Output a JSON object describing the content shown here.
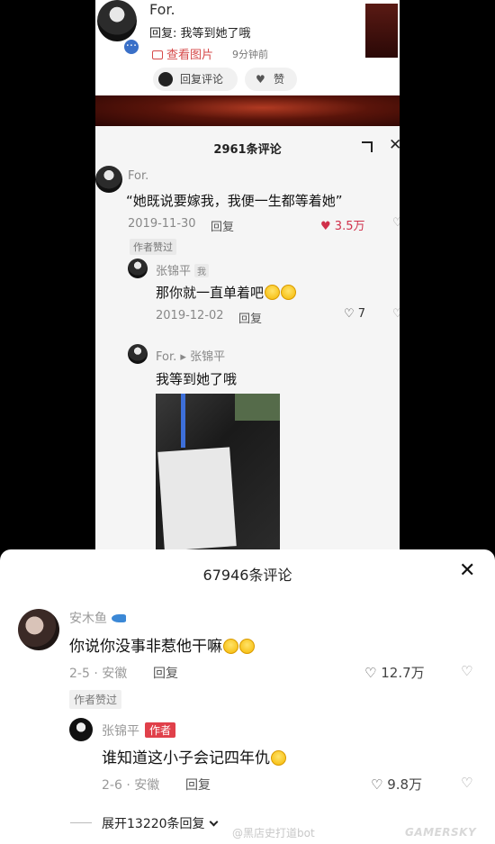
{
  "notification": {
    "username": "For.",
    "reply_text": "回复: 我等到她了哦",
    "view_image": "查看图片",
    "time": "9分钟前",
    "plus_badge": "···",
    "reply_comment_button": "回复评论",
    "like_button": "赞"
  },
  "top_comments": {
    "title": "2961条评论",
    "close": "✕",
    "comment1": {
      "name": "For.",
      "text": "“她既说要嫁我，我便一生都等着她”",
      "date": "2019-11-30",
      "reply": "回复",
      "likes": "3.5万",
      "author_liked": "作者赞过"
    },
    "reply1": {
      "name": "张锦平",
      "me_tag": "我",
      "text": "那你就一直单着吧",
      "date": "2019-12-02",
      "reply": "回复",
      "likes": "7"
    },
    "reply2": {
      "name": "For.",
      "arrow": "▸",
      "to": "张锦平",
      "text": "我等到她了哦"
    }
  },
  "sheet": {
    "title": "67946条评论",
    "close": "✕",
    "comment1": {
      "name": "安木鱼",
      "text": "你说你没事非惹他干嘛",
      "meta": "2-5 · 安徽",
      "reply": "回复",
      "likes": "12.7万",
      "author_liked": "作者赞过"
    },
    "reply1": {
      "name": "张锦平",
      "author_tag": "作者",
      "text": "谁知道这小子会记四年仇",
      "meta": "2-6 · 安徽",
      "reply": "回复",
      "likes": "9.8万"
    },
    "expand": "展开13220条回复",
    "watermark": "@黑店史打道bot",
    "logo": "GAMERSKY"
  },
  "icons": {
    "heart_filled": "♥",
    "heart_outline": "♡",
    "heart_broken": "♡"
  },
  "colors": {
    "accent_red": "#e0404a",
    "like_red": "#d0304a",
    "badge_blue": "#3a70c8"
  }
}
